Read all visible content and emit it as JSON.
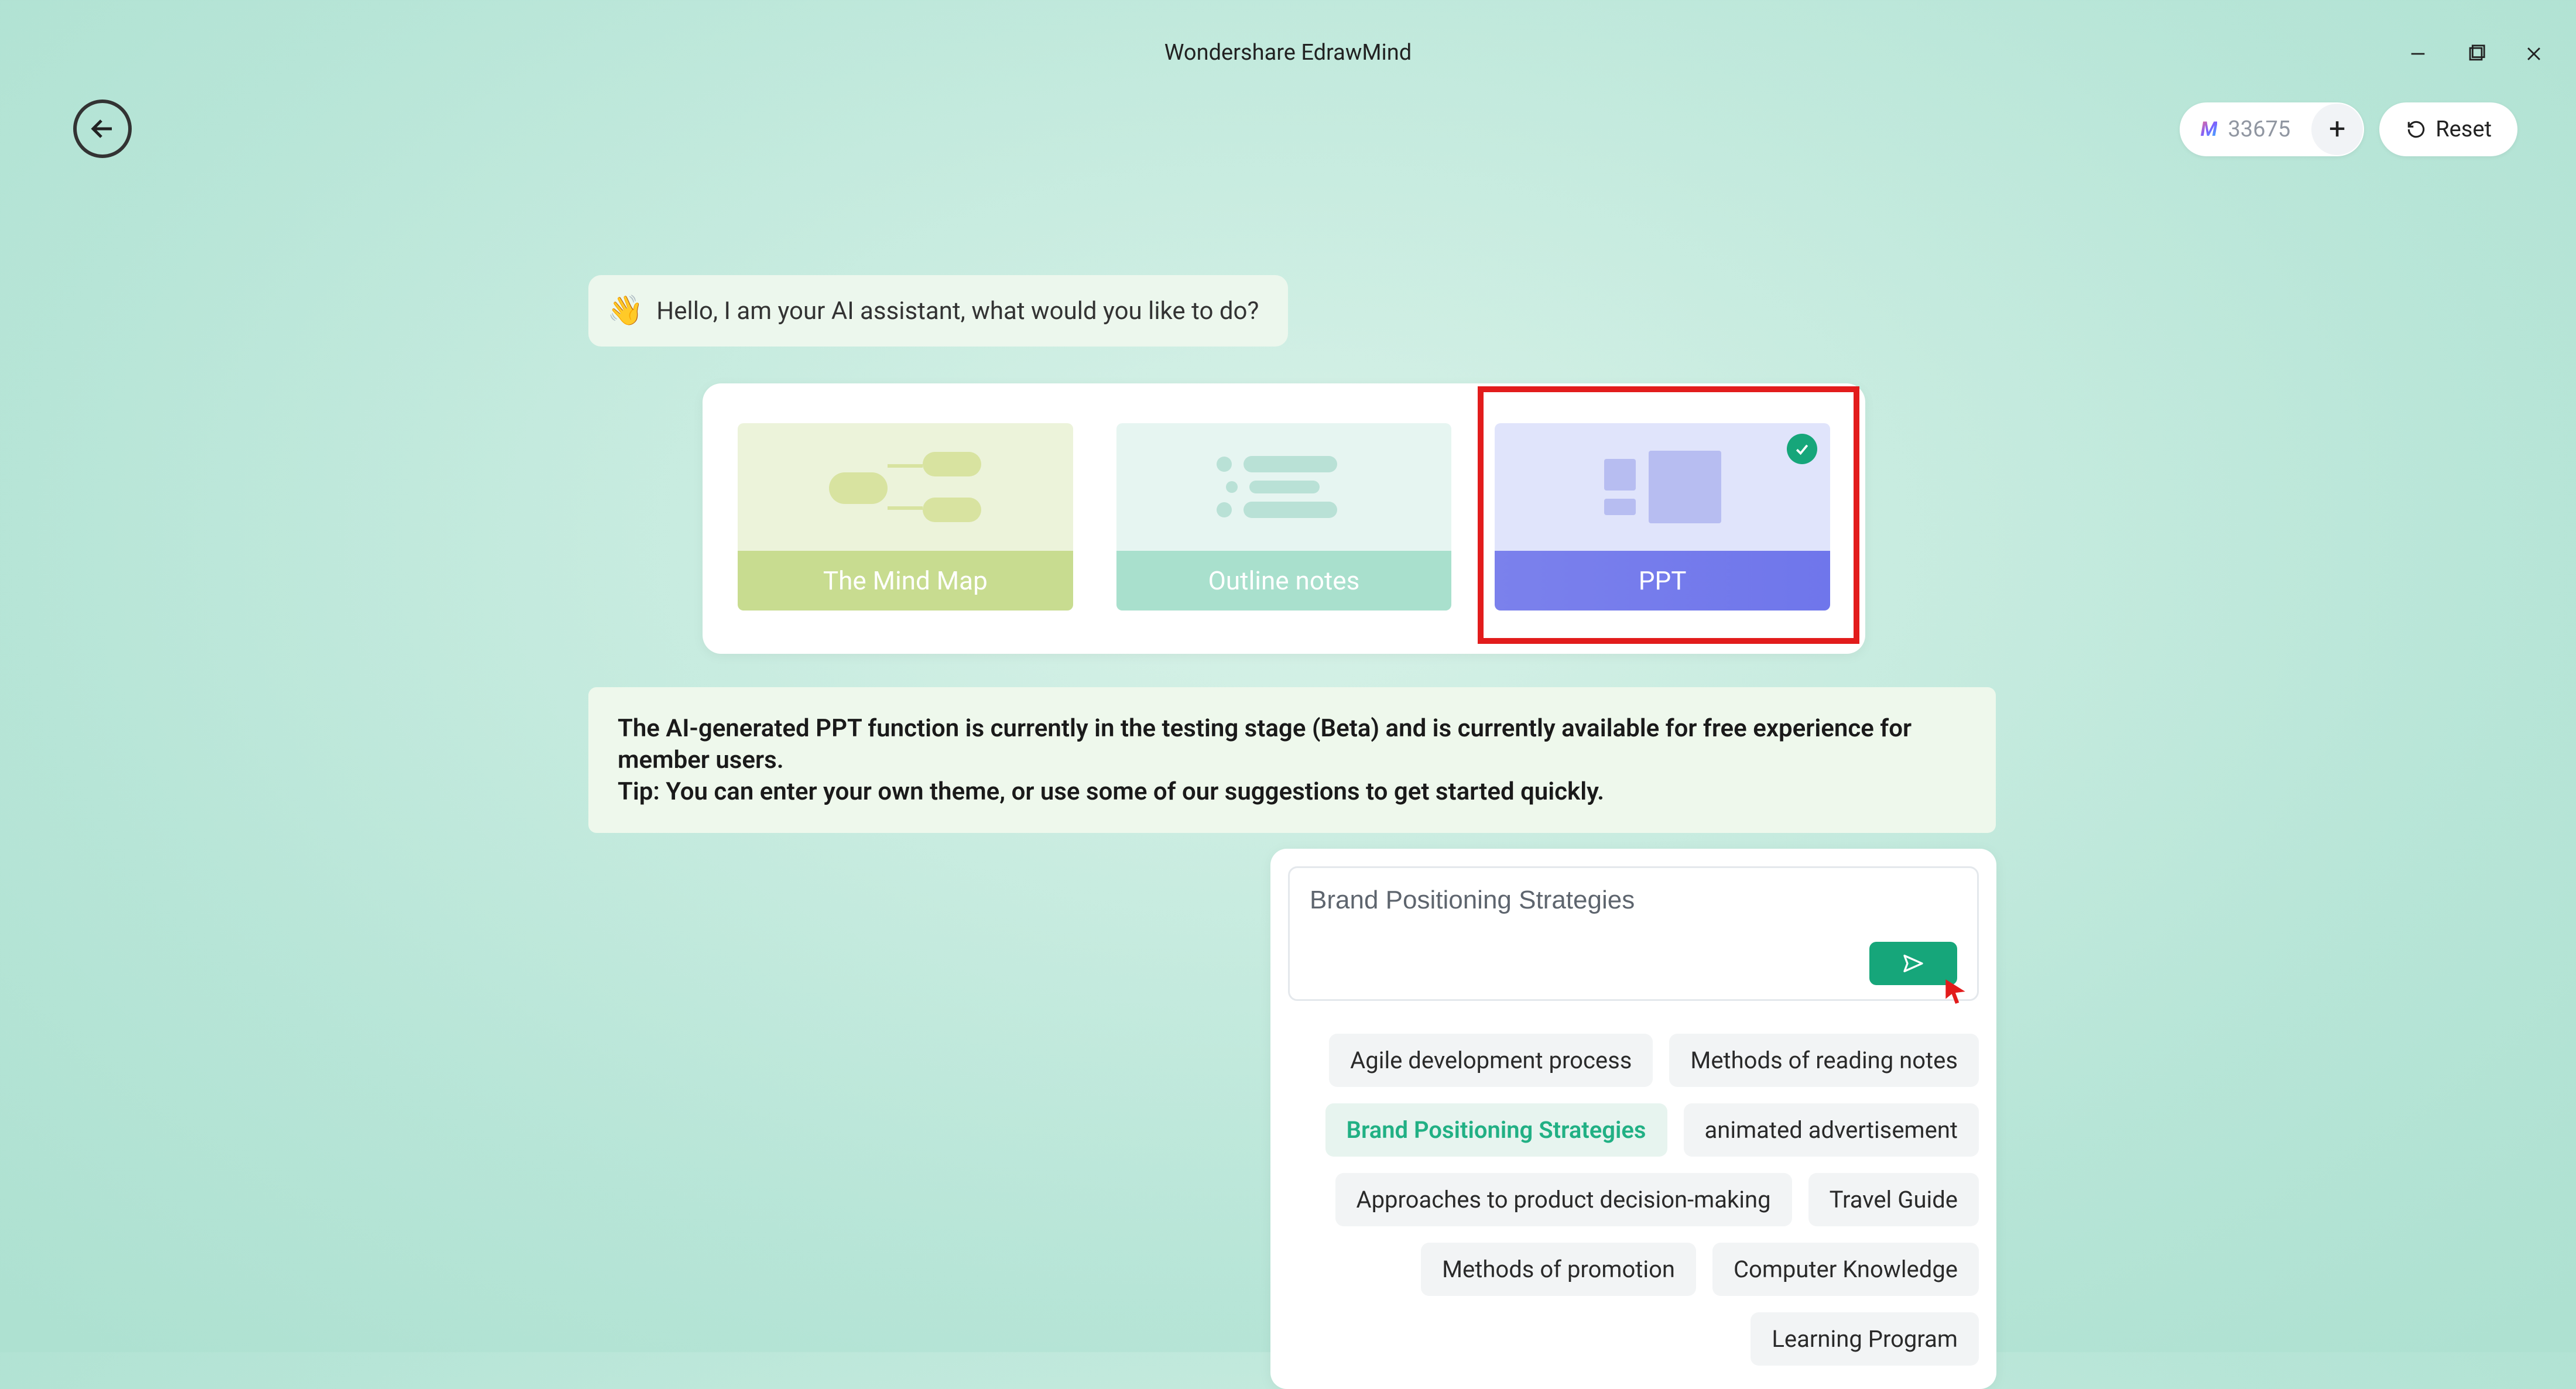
{
  "window": {
    "title": "Wondershare EdrawMind"
  },
  "header": {
    "credits": "33675",
    "reset_label": "Reset"
  },
  "greeting": {
    "text": "Hello, I am your AI assistant, what would you like to do?"
  },
  "options": {
    "items": [
      {
        "label": "The Mind Map"
      },
      {
        "label": "Outline notes"
      },
      {
        "label": "PPT"
      }
    ],
    "selected_index": 2
  },
  "info_banner": {
    "line1": "The AI-generated PPT function is currently in the testing stage (Beta) and is currently available for free experience for member users.",
    "line2": "Tip: You can enter your own theme, or use some of our suggestions to get started quickly."
  },
  "prompt": {
    "value": "Brand Positioning Strategies",
    "suggestions": [
      {
        "label": "Agile development process",
        "active": false
      },
      {
        "label": "Methods of reading notes",
        "active": false
      },
      {
        "label": "Brand Positioning Strategies",
        "active": true
      },
      {
        "label": "animated advertisement",
        "active": false
      },
      {
        "label": "Approaches to product decision-making",
        "active": false
      },
      {
        "label": "Travel Guide",
        "active": false
      },
      {
        "label": "Methods of promotion",
        "active": false
      },
      {
        "label": "Computer Knowledge",
        "active": false
      },
      {
        "label": "Learning Program",
        "active": false
      }
    ]
  }
}
